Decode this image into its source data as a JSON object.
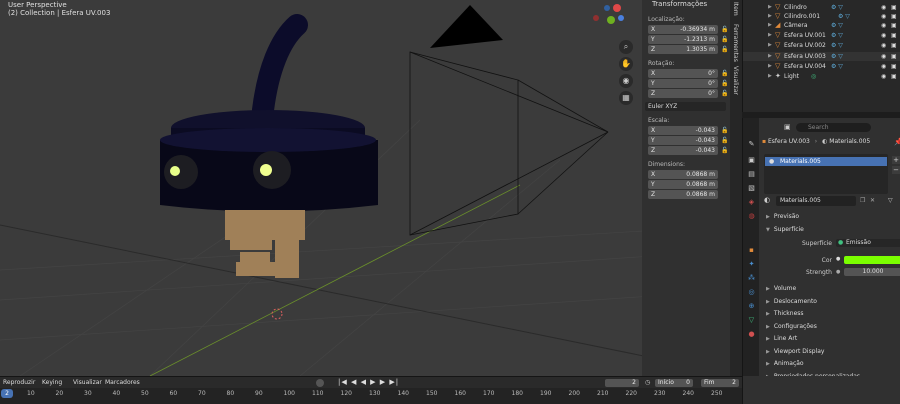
{
  "viewport": {
    "title": "User Perspective",
    "subtitle": "(2) Collection | Esfera UV.003"
  },
  "npanel": {
    "header": "Transformações",
    "location_label": "Localização:",
    "location": [
      {
        "axis": "X",
        "value": "-0.36934 m"
      },
      {
        "axis": "Y",
        "value": "-1.2313 m"
      },
      {
        "axis": "Z",
        "value": "1.3035 m"
      }
    ],
    "rotation_label": "Rotação:",
    "rotation": [
      {
        "axis": "X",
        "value": "0°"
      },
      {
        "axis": "Y",
        "value": "0°"
      },
      {
        "axis": "Z",
        "value": "0°"
      }
    ],
    "rotation_mode": "Euler XYZ",
    "scale_label": "Escala:",
    "scale": [
      {
        "axis": "X",
        "value": "-0.043"
      },
      {
        "axis": "Y",
        "value": "-0.043"
      },
      {
        "axis": "Z",
        "value": "-0.043"
      }
    ],
    "dimensions_label": "Dimensions:",
    "dimensions": [
      {
        "axis": "X",
        "value": "0.0868 m"
      },
      {
        "axis": "Y",
        "value": "0.0868 m"
      },
      {
        "axis": "Z",
        "value": "0.0868 m"
      }
    ],
    "tabs": [
      "Item",
      "Ferramentas",
      "Visualizar"
    ]
  },
  "outliner": {
    "items": [
      "Cilindro",
      "Cilindro.001",
      "Câmera",
      "Esfera UV.001",
      "Esfera UV.002",
      "Esfera UV.003",
      "Esfera UV.004",
      "Light"
    ]
  },
  "properties": {
    "search_placeholder": "Search",
    "breadcrumb_object": "Esfera UV.003",
    "breadcrumb_material": "Materials.005",
    "slot_name": "Materials.005",
    "material_name": "Materials.005",
    "sections": [
      "Previsão",
      "Superfície",
      "Volume",
      "Deslocamento",
      "Thickness",
      "Configurações",
      "Line Art",
      "Viewport Display",
      "Animação",
      "Propriedades personalizadas"
    ],
    "surface_label": "Superfície",
    "surface_value": "Emissão",
    "color_label": "Cor",
    "color_value": "#7bff00",
    "strength_label": "Strength",
    "strength_value": "10.000"
  },
  "timeline": {
    "menus": [
      "Reproduzir",
      "Keying",
      "Visualizar",
      "Marcadores"
    ],
    "current_frame": "2",
    "start_label": "Início",
    "start_value": "0",
    "end_label": "Fim",
    "end_value": "2",
    "ticks": [
      "2",
      "10",
      "20",
      "30",
      "40",
      "50",
      "60",
      "70",
      "80",
      "90",
      "100",
      "110",
      "120",
      "130",
      "140",
      "150",
      "160",
      "170",
      "180",
      "190",
      "200",
      "210",
      "220",
      "230",
      "240",
      "250"
    ]
  }
}
